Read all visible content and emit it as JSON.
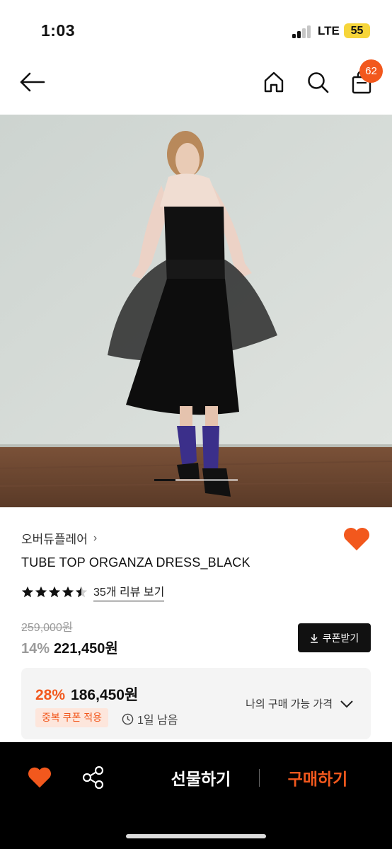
{
  "status_bar": {
    "time": "1:03",
    "network": "LTE",
    "battery": "55"
  },
  "nav": {
    "back_icon": "arrow-left-icon",
    "home_icon": "home-icon",
    "search_icon": "search-icon",
    "cart_icon": "shopping-bag-icon",
    "cart_count": "62"
  },
  "gallery": {
    "current_image": 1,
    "image_count": 4
  },
  "product": {
    "brand": "오버듀플레어",
    "brand_chevron": "›",
    "name": "TUBE TOP ORGANZA DRESS_BLACK",
    "rating": 4.5,
    "review_link": "35개 리뷰 보기",
    "original_price": "259,000원",
    "discount_rate": "14%",
    "price": "221,450원",
    "coupon_button": "쿠폰받기",
    "favorited": true
  },
  "benefit": {
    "discount_rate": "28%",
    "price": "186,450원",
    "badge": "중복 쿠폰 적용",
    "time_left": "1일 남음",
    "my_price_label": "나의 구매 가능 가격"
  },
  "bottom_bar": {
    "gift_label": "선물하기",
    "buy_label": "구매하기"
  },
  "colors": {
    "accent": "#f2581d",
    "battery": "#f6d53a",
    "bottom_bar": "#000000"
  }
}
